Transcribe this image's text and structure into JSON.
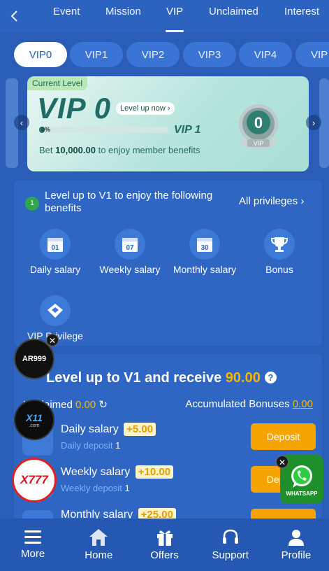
{
  "topnav": {
    "tabs": [
      "Event",
      "Mission",
      "VIP",
      "Unclaimed",
      "Interest"
    ],
    "active": "VIP"
  },
  "vip_tabs": [
    "VIP0",
    "VIP1",
    "VIP2",
    "VIP3",
    "VIP4",
    "VIP"
  ],
  "card": {
    "current_level_label": "Current Level",
    "level": "VIP 0",
    "level_up_button": "Level up now",
    "progress_label": "0%",
    "progress_fraction": 0.0,
    "next_level": "VIP 1",
    "bet_prefix": "Bet ",
    "bet_amount": "10,000.00",
    "bet_suffix": " to enjoy member benefits",
    "badge_number": "0",
    "badge_text": "VIP"
  },
  "benefits": {
    "title": "Level up to V1 to enjoy the following benefits",
    "all_privileges": "All privileges",
    "items": [
      {
        "label": "Daily salary",
        "icon_text": "01"
      },
      {
        "label": "Weekly salary",
        "icon_text": "07"
      },
      {
        "label": "Monthly salary",
        "icon_text": "30"
      },
      {
        "label": "Bonus",
        "icon_text": ""
      },
      {
        "label": "VIP Privilege",
        "icon_text": ""
      }
    ]
  },
  "receive": {
    "title_prefix": "Level up to V1 and receive ",
    "amount": "90.00",
    "unclaimed_label": "Unclaimed",
    "unclaimed_value": "0.00",
    "accumulated_label": "Accumulated Bonuses",
    "accumulated_value": "0.00",
    "rows": [
      {
        "name": "Daily salary",
        "bonus": "+5.00",
        "sub_label": "Daily deposit",
        "sub_value": "1",
        "button": "Deposit"
      },
      {
        "name": "Weekly salary",
        "bonus": "+10.00",
        "sub_label": "Weekly deposit",
        "sub_value": "1",
        "button": "Deposit"
      },
      {
        "name": "Monthly salary",
        "bonus": "+25.00",
        "sub_label": "",
        "sub_value": "",
        "button": "Deposit"
      }
    ]
  },
  "floating": {
    "ar999": "AR999",
    "x11": "X11",
    "x11_sub": ".com",
    "x777": "X777",
    "whatsapp": "WHATSAPP"
  },
  "bottomnav": [
    "More",
    "Home",
    "Offers",
    "Support",
    "Profile"
  ]
}
